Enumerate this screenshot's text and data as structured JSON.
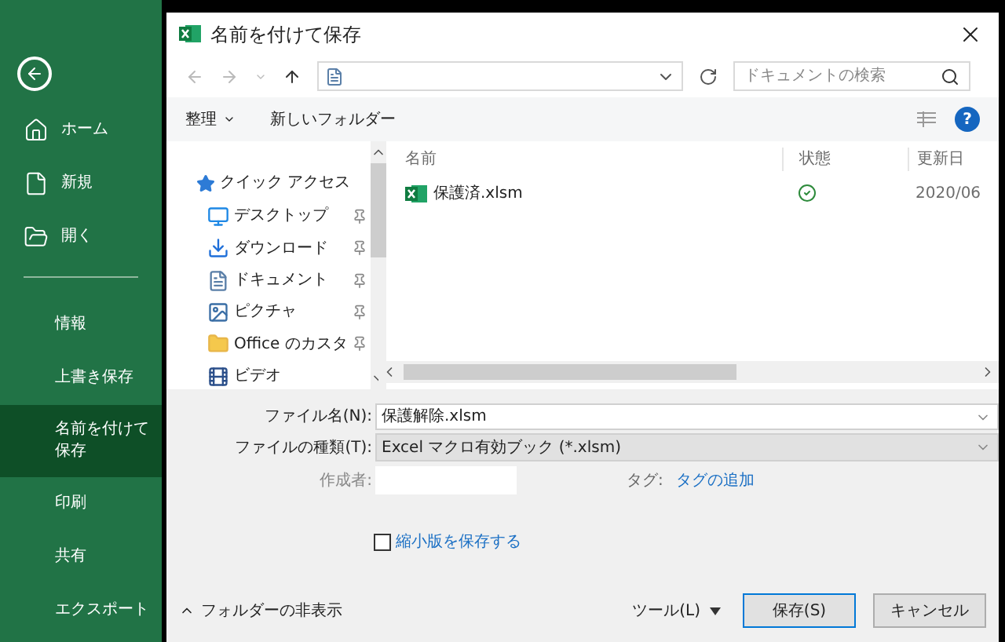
{
  "sidebar": {
    "items": [
      {
        "label": "ホーム",
        "kind": "home",
        "selected": false
      },
      {
        "label": "新規",
        "kind": "new",
        "selected": false
      },
      {
        "label": "開く",
        "kind": "open",
        "selected": false
      },
      {
        "label": "情報",
        "kind": "plain",
        "selected": false
      },
      {
        "label": "上書き保存",
        "kind": "plain",
        "selected": false
      },
      {
        "label": "名前を付けて保存",
        "kind": "plain",
        "selected": true
      },
      {
        "label": "印刷",
        "kind": "plain",
        "selected": false
      },
      {
        "label": "共有",
        "kind": "plain",
        "selected": false
      },
      {
        "label": "エクスポート",
        "kind": "plain",
        "selected": false
      }
    ]
  },
  "dialog": {
    "title": "名前を付けて保存",
    "search": {
      "placeholder": "ドキュメントの検索"
    },
    "help": "?",
    "toolbar": [
      "整理",
      "新しいフォルダー"
    ],
    "nav_pane": {
      "header": "クイック アクセス",
      "items": [
        {
          "label": "デスクトップ",
          "kind": "desktop",
          "pinned": true
        },
        {
          "label": "ダウンロード",
          "kind": "download",
          "pinned": true
        },
        {
          "label": "ドキュメント",
          "kind": "document",
          "pinned": true
        },
        {
          "label": "ピクチャ",
          "kind": "picture",
          "pinned": true
        },
        {
          "label": "Office のカスタ",
          "kind": "folder",
          "pinned": true
        },
        {
          "label": "ビデオ",
          "kind": "video",
          "pinned": false
        }
      ]
    },
    "file_list": {
      "columns": [
        "名前",
        "状態",
        "更新日"
      ],
      "rows": [
        {
          "name": "保護済.xlsm",
          "synced": true,
          "modified": "2020/06"
        }
      ]
    },
    "form": {
      "file_name_label": "ファイル名(N):",
      "file_name": "保護解除.xlsm",
      "file_type_label": "ファイルの種類(T):",
      "file_type": "Excel マクロ有効ブック (*.xlsm)",
      "author_label": "作成者:",
      "tags_label": "タグ:",
      "tags_link": "タグの追加",
      "thumbnail": {
        "label": "縮小版を保存する",
        "checked": false
      }
    },
    "footer": {
      "hide_folders": "フォルダーの非表示",
      "tools": "ツール(L)",
      "save": "保存(S)",
      "cancel": "キャンセル"
    }
  }
}
